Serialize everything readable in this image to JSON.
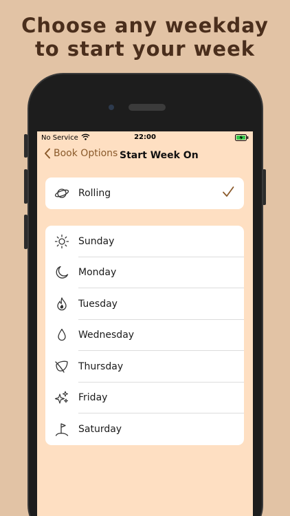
{
  "headline": {
    "line1": "Choose any weekday",
    "line2": "to start your week"
  },
  "status_bar": {
    "carrier": "No Service",
    "time": "22:00",
    "icons": [
      "wifi-icon",
      "battery-charging-icon"
    ]
  },
  "nav": {
    "back_label": "Book Options",
    "title": "Start Week On"
  },
  "rolling": {
    "label": "Rolling",
    "icon": "planet-icon",
    "selected": true
  },
  "days": [
    {
      "label": "Sunday",
      "icon": "sun-icon"
    },
    {
      "label": "Monday",
      "icon": "moon-icon"
    },
    {
      "label": "Tuesday",
      "icon": "flame-icon"
    },
    {
      "label": "Wednesday",
      "icon": "drop-icon"
    },
    {
      "label": "Thursday",
      "icon": "leaf-icon"
    },
    {
      "label": "Friday",
      "icon": "sparkles-icon"
    },
    {
      "label": "Saturday",
      "icon": "flag-icon"
    }
  ],
  "colors": {
    "background": "#e2c3a5",
    "screen": "#fedfc2",
    "accent": "#8a5a2b",
    "headline": "#4a2e1c"
  }
}
